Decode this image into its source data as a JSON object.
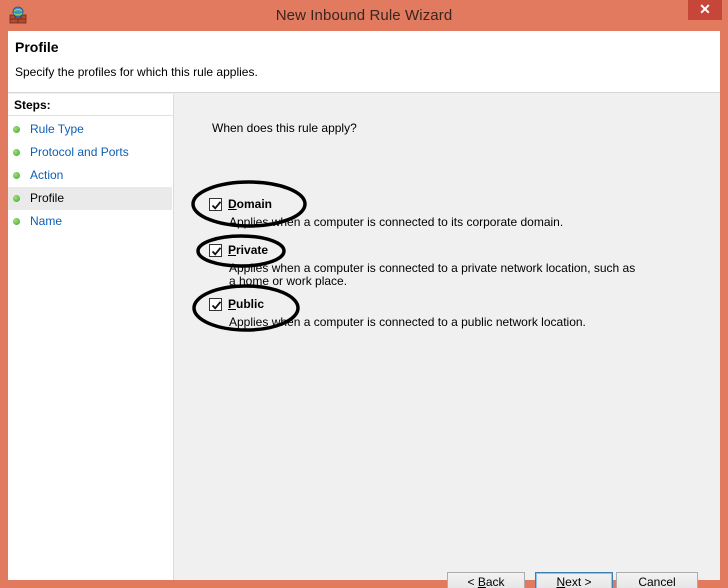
{
  "window": {
    "title": "New Inbound Rule Wizard",
    "close_glyph": "✕",
    "accent_color": "#e17a5f"
  },
  "header": {
    "title": "Profile",
    "description": "Specify the profiles for which this rule applies."
  },
  "steps": {
    "heading": "Steps:",
    "items": [
      {
        "label": "Rule Type",
        "current": false
      },
      {
        "label": "Protocol and Ports",
        "current": false
      },
      {
        "label": "Action",
        "current": false
      },
      {
        "label": "Profile",
        "current": true
      },
      {
        "label": "Name",
        "current": false
      }
    ]
  },
  "content": {
    "question": "When does this rule apply?",
    "options": [
      {
        "label_mnemonic": "D",
        "label_rest": "omain",
        "checked": true,
        "description": "Applies when a computer is connected to its corporate domain."
      },
      {
        "label_mnemonic": "P",
        "label_rest": "rivate",
        "checked": true,
        "description": "Applies when a computer is connected to a private network location, such as a home or work place."
      },
      {
        "label_mnemonic": "P",
        "label_rest": "ublic",
        "checked": true,
        "description": "Applies when a computer is connected to a public network location."
      }
    ]
  },
  "buttons": {
    "back_prefix": "< ",
    "back_mnemonic": "B",
    "back_rest": "ack",
    "next_mnemonic": "N",
    "next_rest": "ext >",
    "cancel": "Cancel"
  }
}
